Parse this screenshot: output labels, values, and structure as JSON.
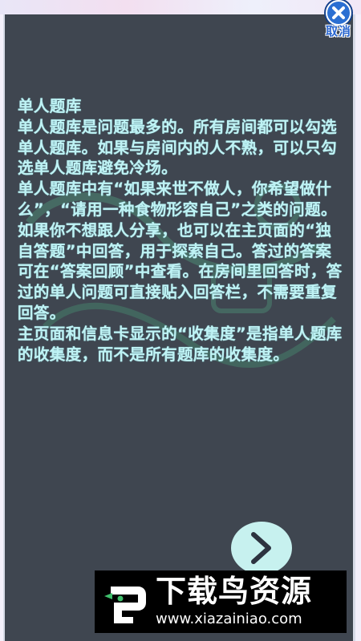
{
  "dialog": {
    "close_label": "取消",
    "paragraphs": [
      "单人题库",
      "单人题库是问题最多的。所有房间都可以勾选单人题库。如果与房间内的人不熟，可以只勾选单人题库避免冷场。",
      "单人题库中有“如果来世不做人，你希望做什么”，“请用一种食物形容自己”之类的问题。如果你不想跟人分享，也可以在主页面的“独自答题”中回答，用于探索自己。答过的答案可在“答案回顾”中查看。在房间里回答时，答过的单人问题可直接贴入回答栏，不需要重复回答。",
      "主页面和信息卡显示的“收集度”是指单人题库的收集度，而不是所有题库的收集度。"
    ]
  },
  "watermark": {
    "title": "下载鸟资源",
    "url": "www.xiazainiao.com"
  },
  "colors": {
    "panel_bg": "#3f4650",
    "text": "#bff2f4",
    "next_button": "#c7f1ef",
    "close_blue": "#2b6fd2"
  },
  "icons": {
    "close": "close-x-icon",
    "next": "chevron-right-icon",
    "watermark_logo": "bird-logo-icon"
  }
}
